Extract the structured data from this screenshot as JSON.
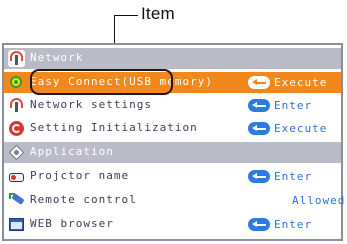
{
  "callout": {
    "label": "Item"
  },
  "menu": {
    "rows": [
      {
        "type": "header",
        "icon": "network-icon",
        "label": "Network"
      },
      {
        "type": "item",
        "icon": "easy-connect-icon",
        "label": "Easy Connect(USB memory)",
        "action": "Execute",
        "selected": true
      },
      {
        "type": "item",
        "icon": "network-settings-icon",
        "label": "Network settings",
        "action": "Enter"
      },
      {
        "type": "item",
        "icon": "setting-initialization-icon",
        "label": "Setting Initialization",
        "action": "Execute"
      },
      {
        "type": "header",
        "icon": "application-icon",
        "label": "Application"
      },
      {
        "type": "item",
        "icon": "projector-icon",
        "label": "Projctor name",
        "action": "Enter"
      },
      {
        "type": "item",
        "icon": "remote-control-icon",
        "label": "Remote control",
        "value": "Allowed"
      },
      {
        "type": "item",
        "icon": "web-browser-icon",
        "label": "WEB browser",
        "action": "Enter"
      }
    ]
  },
  "colors": {
    "selected_bg": "#f2871c",
    "header_bg": "#b9bcc6",
    "enter_button": "#2e7be0",
    "text": "#3b3f5a"
  }
}
